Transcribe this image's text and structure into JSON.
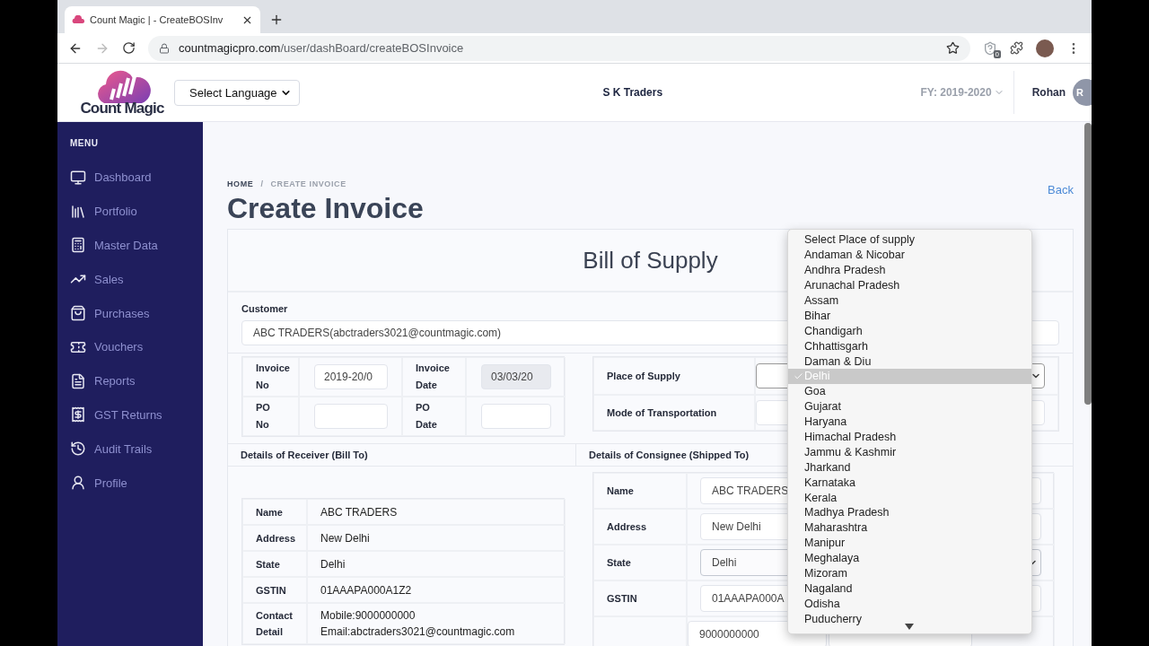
{
  "browser": {
    "tab_title": "Count Magic | - CreateBOSInv",
    "url_host": "countmagicpro.com",
    "url_path": "/user/dashBoard/createBOSInvoice",
    "extension_badge": "0"
  },
  "header": {
    "logo_text": "Count Magic",
    "language_select": "Select Language",
    "company": "S K Traders",
    "fiscal_year": "FY: 2019-2020",
    "user": "Rohan",
    "avatar_initials": "R"
  },
  "sidebar": {
    "heading": "MENU",
    "items": [
      {
        "label": "Dashboard"
      },
      {
        "label": "Portfolio"
      },
      {
        "label": "Master Data"
      },
      {
        "label": "Sales"
      },
      {
        "label": "Purchases"
      },
      {
        "label": "Vouchers"
      },
      {
        "label": "Reports"
      },
      {
        "label": "GST Returns"
      },
      {
        "label": "Audit Trails"
      },
      {
        "label": "Profile"
      }
    ]
  },
  "breadcrumb": [
    {
      "label": "HOME",
      "current": false
    },
    {
      "label": "CREATE INVOICE",
      "current": true
    }
  ],
  "breadcrumb_separator": "/",
  "page_title": "Create Invoice",
  "back_link": "Back",
  "card_title": "Bill of Supply",
  "customer": {
    "label": "Customer",
    "value": "ABC TRADERS(abctraders3021@countmagic.com)"
  },
  "invoice_fields": [
    {
      "label": "Invoice No",
      "value": "2019-20/0",
      "disabled": false
    },
    {
      "label": "Invoice Date",
      "value": "03/03/20",
      "disabled": true
    },
    {
      "label": "PO No",
      "disabled": false
    },
    {
      "label": "PO Date",
      "disabled": false
    }
  ],
  "supply_fields": [
    {
      "label": "Place of Supply",
      "kind": "select"
    },
    {
      "label": "Mode of Transportation",
      "kind": "input"
    }
  ],
  "bill_to": {
    "heading": "Details of Receiver (Bill To)",
    "rows": [
      {
        "label": "Name",
        "lines": [
          "ABC TRADERS"
        ]
      },
      {
        "label": "Address",
        "lines": [
          "New Delhi"
        ]
      },
      {
        "label": "State",
        "lines": [
          "Delhi"
        ]
      },
      {
        "label": "GSTIN",
        "lines": [
          "01AAAPA000A1Z2"
        ]
      },
      {
        "label": "Contact Detail",
        "lines": [
          "Mobile:9000000000",
          "Email:abctraders3021@countmagic.com"
        ]
      }
    ]
  },
  "ship_to": {
    "heading": "Details of Consignee (Shipped To)",
    "rows": [
      {
        "label": "Name",
        "value": "ABC TRADERS",
        "kind": "input"
      },
      {
        "label": "Address",
        "value": "New Delhi",
        "kind": "input"
      },
      {
        "label": "State",
        "value": "Delhi",
        "kind": "select"
      },
      {
        "label": "GSTIN",
        "value": "01AAAPA000A",
        "kind": "input"
      }
    ],
    "contact": {
      "phone": "9000000000"
    }
  },
  "dropdown": {
    "options": [
      {
        "label": "Select Place of supply",
        "selected": false
      },
      {
        "label": "Andaman & Nicobar",
        "selected": false
      },
      {
        "label": "Andhra Pradesh",
        "selected": false
      },
      {
        "label": "Arunachal Pradesh",
        "selected": false
      },
      {
        "label": "Assam",
        "selected": false
      },
      {
        "label": "Bihar",
        "selected": false
      },
      {
        "label": "Chandigarh",
        "selected": false
      },
      {
        "label": "Chhattisgarh",
        "selected": false
      },
      {
        "label": "Daman & Diu",
        "selected": false
      },
      {
        "label": "Delhi",
        "selected": true
      },
      {
        "label": "Goa",
        "selected": false
      },
      {
        "label": "Gujarat",
        "selected": false
      },
      {
        "label": "Haryana",
        "selected": false
      },
      {
        "label": "Himachal Pradesh",
        "selected": false
      },
      {
        "label": "Jammu & Kashmir",
        "selected": false
      },
      {
        "label": "Jharkand",
        "selected": false
      },
      {
        "label": "Karnataka",
        "selected": false
      },
      {
        "label": "Kerala",
        "selected": false
      },
      {
        "label": "Madhya Pradesh",
        "selected": false
      },
      {
        "label": "Maharashtra",
        "selected": false
      },
      {
        "label": "Manipur",
        "selected": false
      },
      {
        "label": "Meghalaya",
        "selected": false
      },
      {
        "label": "Mizoram",
        "selected": false
      },
      {
        "label": "Nagaland",
        "selected": false
      },
      {
        "label": "Odisha",
        "selected": false
      },
      {
        "label": "Puducherry",
        "selected": false
      }
    ]
  }
}
